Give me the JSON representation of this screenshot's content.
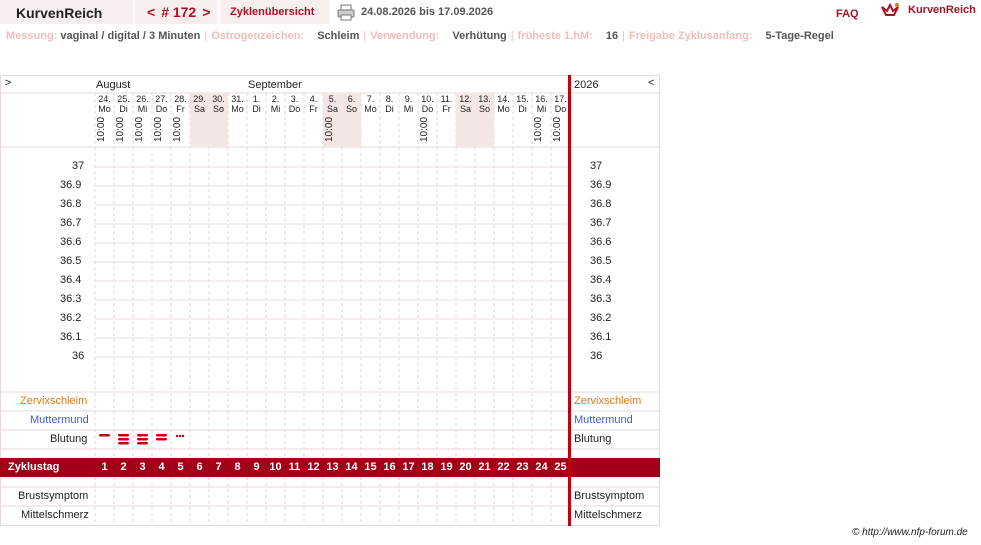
{
  "header": {
    "brand": "KurvenReich",
    "cycle_prev": "<",
    "cycle_label": "# 172",
    "cycle_next": ">",
    "overview_tab": "Zyklenübersicht",
    "date_range": "24.08.2026 bis 17.09.2026",
    "faq": "FAQ",
    "logo_text": "KurvenReich"
  },
  "meta": {
    "messung_label": "Messung:",
    "messung_value": "vaginal / digital / 3 Minuten",
    "oestrogen_label": "Östrogenzeichen:",
    "oestrogen_value": "Schleim",
    "verwendung_label": "Verwendung:",
    "verwendung_value": "Verhütung",
    "hm_label": "früheste 1.hM:",
    "hm_value": "16",
    "freigabe_label": "Freigabe Zyklusanfang:",
    "freigabe_value": "5-Tage-Regel"
  },
  "chart": {
    "nav_left": ">",
    "nav_right": "<",
    "month1": "August",
    "month2": "September",
    "year": "2026",
    "temps": [
      "37",
      "36.9",
      "36.8",
      "36.7",
      "36.6",
      "36.5",
      "36.4",
      "36.3",
      "36.2",
      "36.1",
      "36"
    ],
    "days": [
      {
        "d": "24.",
        "w": "Mo",
        "t": "10:00",
        "we": false
      },
      {
        "d": "25.",
        "w": "Di",
        "t": "10:00",
        "we": false
      },
      {
        "d": "26.",
        "w": "Mi",
        "t": "10:00",
        "we": false
      },
      {
        "d": "27.",
        "w": "Do",
        "t": "10:00",
        "we": false
      },
      {
        "d": "28.",
        "w": "Fr",
        "t": "10:00",
        "we": false
      },
      {
        "d": "29.",
        "w": "Sa",
        "t": "",
        "we": true
      },
      {
        "d": "30.",
        "w": "So",
        "t": "",
        "we": true
      },
      {
        "d": "31.",
        "w": "Mo",
        "t": "",
        "we": false
      },
      {
        "d": "1.",
        "w": "Di",
        "t": "",
        "we": false
      },
      {
        "d": "2.",
        "w": "Mi",
        "t": "",
        "we": false
      },
      {
        "d": "3.",
        "w": "Do",
        "t": "",
        "we": false
      },
      {
        "d": "4.",
        "w": "Fr",
        "t": "",
        "we": false
      },
      {
        "d": "5.",
        "w": "Sa",
        "t": "10:00",
        "we": true
      },
      {
        "d": "6.",
        "w": "So",
        "t": "",
        "we": true
      },
      {
        "d": "7.",
        "w": "Mo",
        "t": "",
        "we": false
      },
      {
        "d": "8.",
        "w": "Di",
        "t": "",
        "we": false
      },
      {
        "d": "9.",
        "w": "Mi",
        "t": "",
        "we": false
      },
      {
        "d": "10.",
        "w": "Do",
        "t": "10:00",
        "we": false
      },
      {
        "d": "11.",
        "w": "Fr",
        "t": "",
        "we": false
      },
      {
        "d": "12.",
        "w": "Sa",
        "t": "",
        "we": true
      },
      {
        "d": "13.",
        "w": "So",
        "t": "",
        "we": true
      },
      {
        "d": "14.",
        "w": "Mo",
        "t": "",
        "we": false
      },
      {
        "d": "15.",
        "w": "Di",
        "t": "",
        "we": false
      },
      {
        "d": "16.",
        "w": "Mi",
        "t": "10:00",
        "we": false
      },
      {
        "d": "17.",
        "w": "Do",
        "t": "10:00",
        "we": false
      }
    ],
    "rows": {
      "zervix": "Zervixschleim",
      "muttermund": "Muttermund",
      "blutung": "Blutung",
      "zyklustag": "Zyklustag",
      "brust": "Brustsymptom",
      "mittel": "Mittelschmerz"
    },
    "bleeding": [
      1,
      3,
      3,
      2,
      0.5
    ],
    "cycle_days": [
      "1",
      "2",
      "3",
      "4",
      "5",
      "6",
      "7",
      "8",
      "9",
      "10",
      "11",
      "12",
      "13",
      "14",
      "15",
      "16",
      "17",
      "18",
      "19",
      "20",
      "21",
      "22",
      "23",
      "24",
      "25"
    ],
    "colors": {
      "accent": "#a00018",
      "zervix": "#e07a10",
      "muttermund": "#4060c0"
    }
  },
  "footer": {
    "copyright": "© http://www.nfp-forum.de"
  }
}
